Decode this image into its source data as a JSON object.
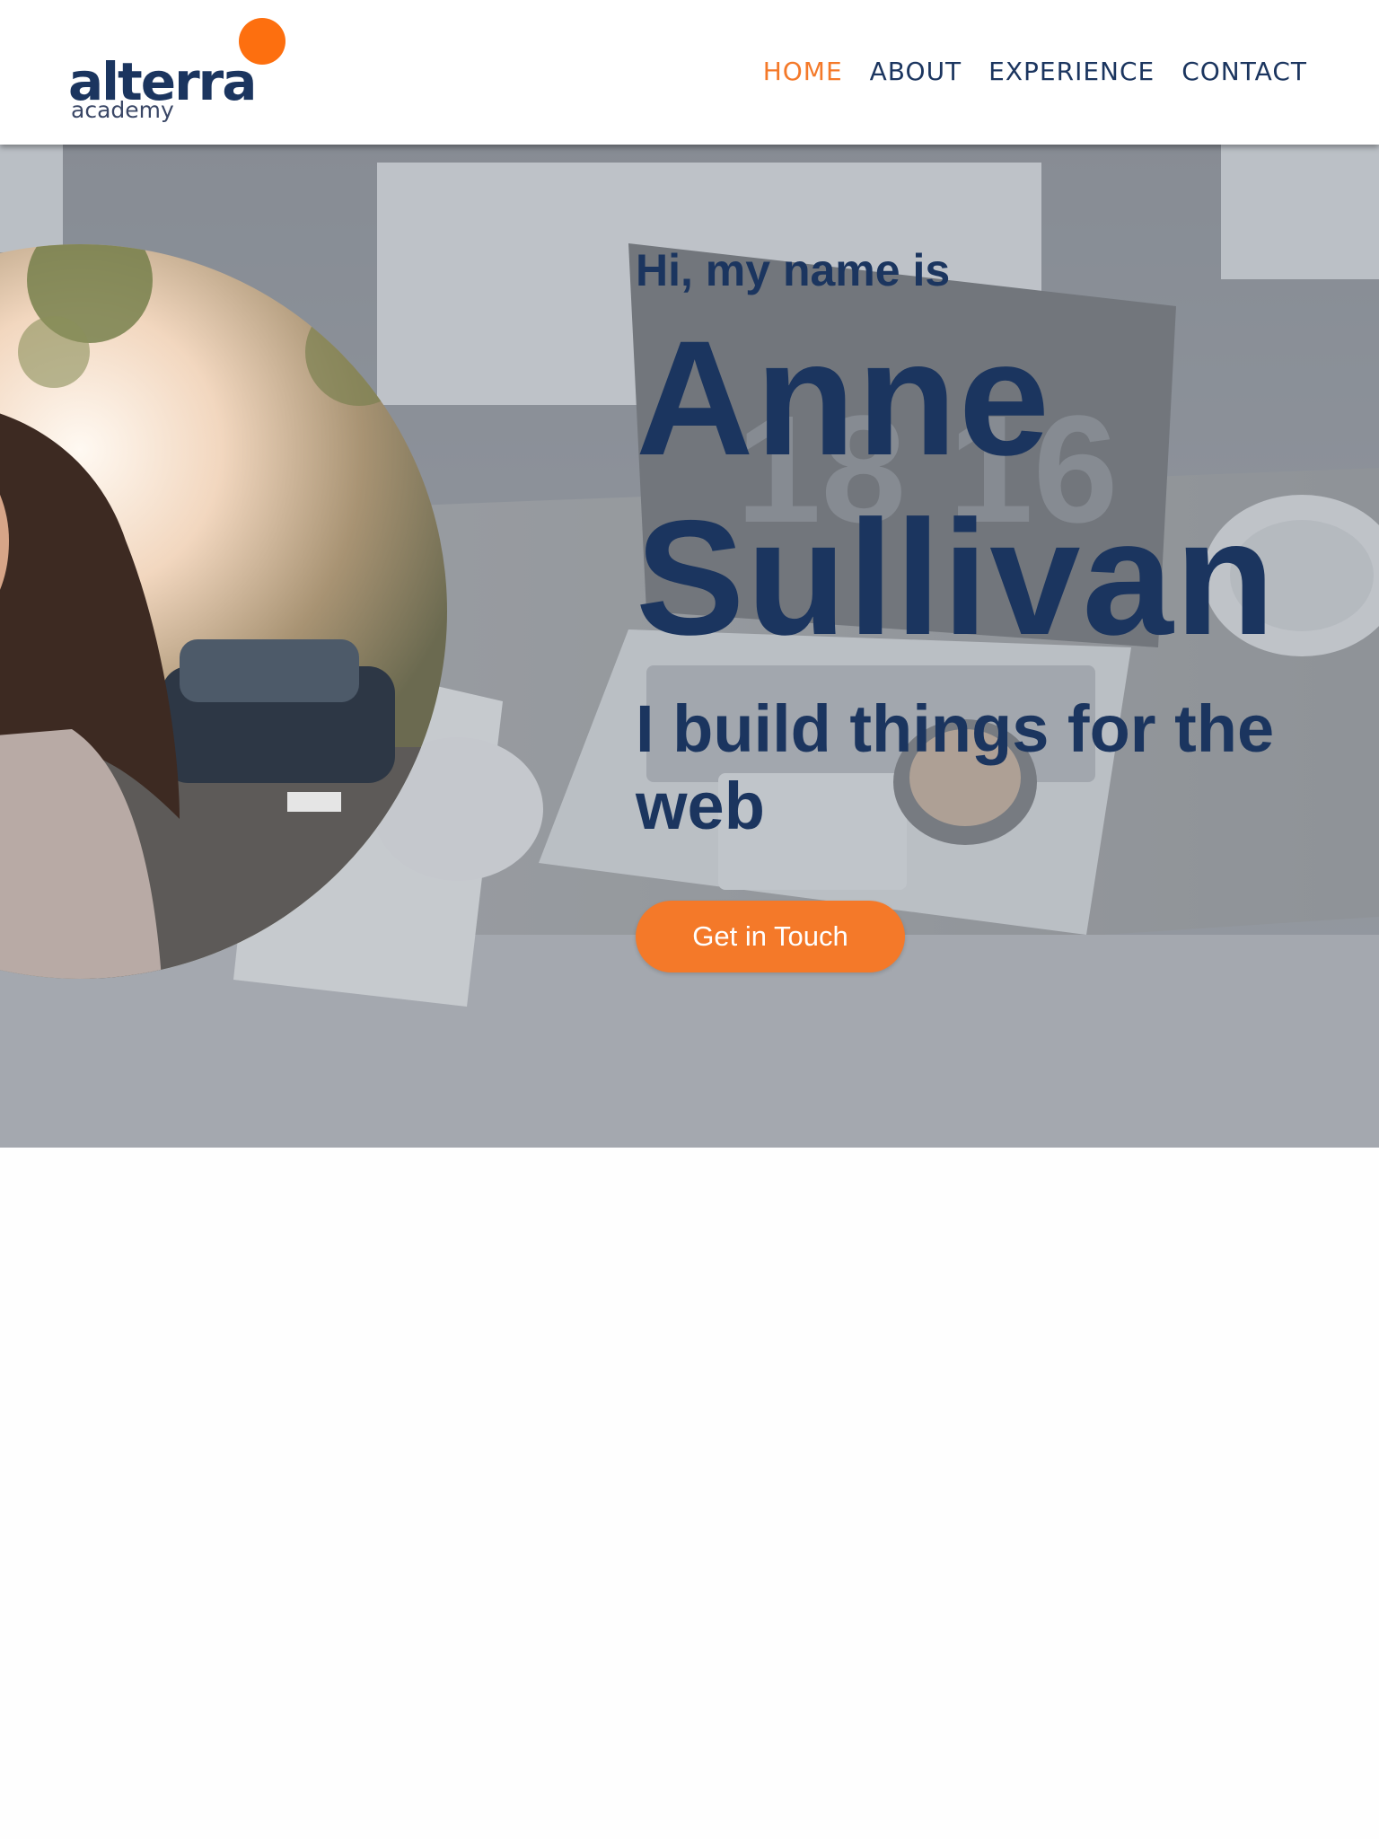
{
  "theme": {
    "navy": "#1b355f",
    "orange": "#f47929",
    "logo_orange": "#fd6f0f",
    "logo_sub": "#3a4766"
  },
  "header": {
    "logo": {
      "main": "alterra",
      "sub": "academy"
    },
    "nav": [
      {
        "label": "HOME",
        "active": true
      },
      {
        "label": "ABOUT",
        "active": false
      },
      {
        "label": "EXPERIENCE",
        "active": false
      },
      {
        "label": "CONTACT",
        "active": false
      }
    ]
  },
  "hero": {
    "greeting": "Hi, my name is",
    "name_first": "Anne",
    "name_last": "Sullivan",
    "tagline": "I build things for the web",
    "cta_label": "Get in Touch",
    "portrait_icon": "profile-photo",
    "background_icon": "laptop-desk-photo"
  }
}
